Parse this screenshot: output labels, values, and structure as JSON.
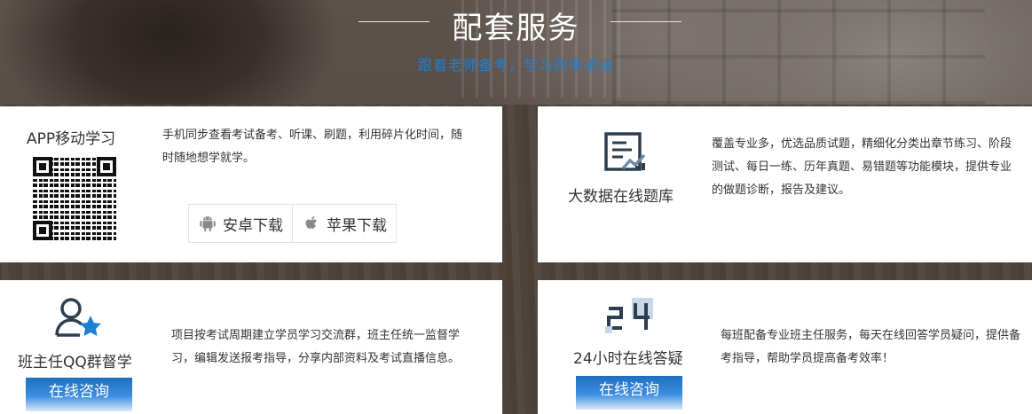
{
  "header": {
    "title": "配套服务",
    "subtitle": "跟着老师备考，学习效率更高"
  },
  "cards": {
    "app": {
      "title": "APP移动学习",
      "description": "手机同步查看考试备考、听课、刷题，利用碎片化时间，随时随地想学就学。",
      "android_label": "安卓下载",
      "ios_label": "苹果下载"
    },
    "bank": {
      "title": "大数据在线题库",
      "description": "覆盖专业多，优选品质试题，精细化分类出章节练习、阶段测试、每日一练、历年真题、易错题等功能模块，提供专业的做题诊断，报告及建议。"
    },
    "qq": {
      "title": "班主任QQ群督学",
      "description": "项目按考试周期建立学员学习交流群，班主任统一监督学习，编辑发送报考指导，分享内部资料及考试直播信息。",
      "button": "在线咨询"
    },
    "answer": {
      "title": "24小时在线答疑",
      "description": "每班配备专业班主任服务，每天在线回答学员疑问，提供备考指导，帮助学员提高备考效率！",
      "button": "在线咨询"
    }
  },
  "icons": {
    "qr": "qr-code-icon",
    "android": "android-icon",
    "apple": "apple-icon",
    "bank": "report-chart-icon",
    "qq": "user-star-icon",
    "answer": "24-hours-icon"
  },
  "colors": {
    "accent": "#1f7fd0",
    "button_blue": "#1e6fbf",
    "card_bg": "#ffffff"
  }
}
